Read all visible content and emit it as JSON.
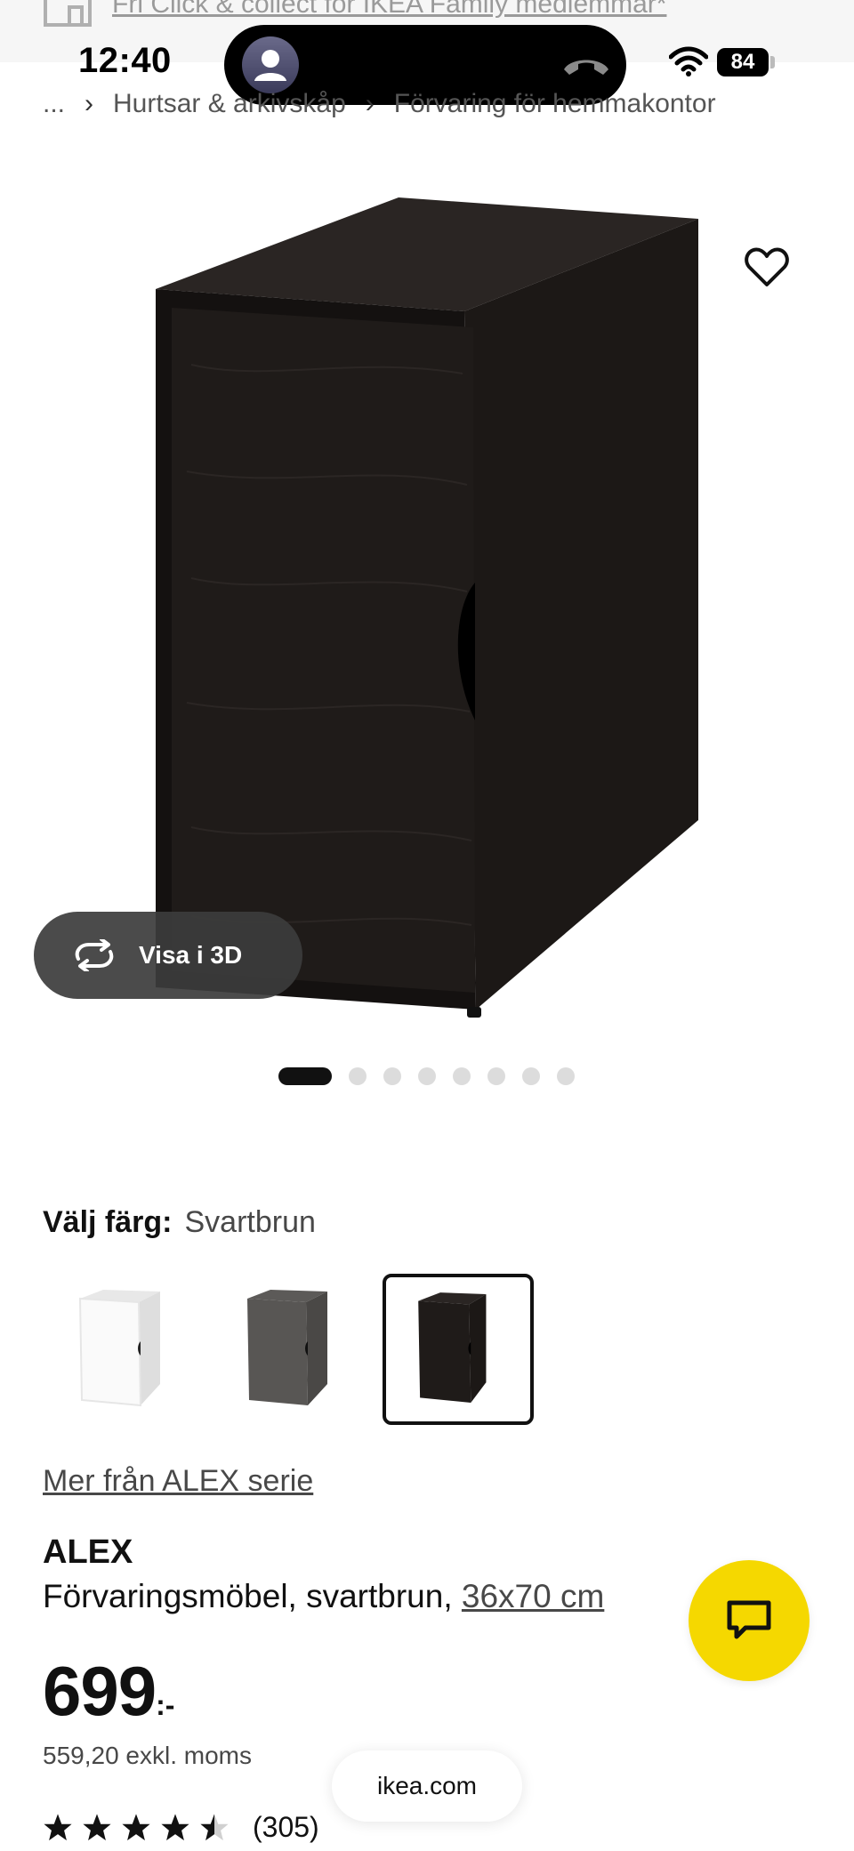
{
  "promo": {
    "text": "Fri Click & collect för IKEA Family medlemmar*",
    "icon": "store-icon"
  },
  "status_bar": {
    "time": "12:40",
    "battery": "84"
  },
  "breadcrumb": {
    "ellipsis": "...",
    "items": [
      "Hurtsar & arkivskåp",
      "Förvaring för hemmakontor"
    ]
  },
  "gallery": {
    "view3d_label": "Visa i 3D",
    "image_count": 8,
    "active_index": 0
  },
  "color": {
    "label": "Välj färg:",
    "selected_value": "Svartbrun",
    "swatches": [
      "white",
      "grey",
      "black-brown"
    ],
    "selected_index": 2
  },
  "series_link": "Mer från ALEX serie",
  "product": {
    "name": "ALEX",
    "description": "Förvaringsmöbel, svartbrun, ",
    "size": "36x70 cm"
  },
  "price": {
    "integer": "699",
    "suffix": ":-",
    "excl_vat": "559,20 exkl. moms"
  },
  "rating": {
    "stars": 4.5,
    "count": "(305)"
  },
  "footer": {
    "url": "ikea.com"
  },
  "colors": {
    "accent": "#f5d800",
    "text": "#111111",
    "muted": "#484848"
  }
}
